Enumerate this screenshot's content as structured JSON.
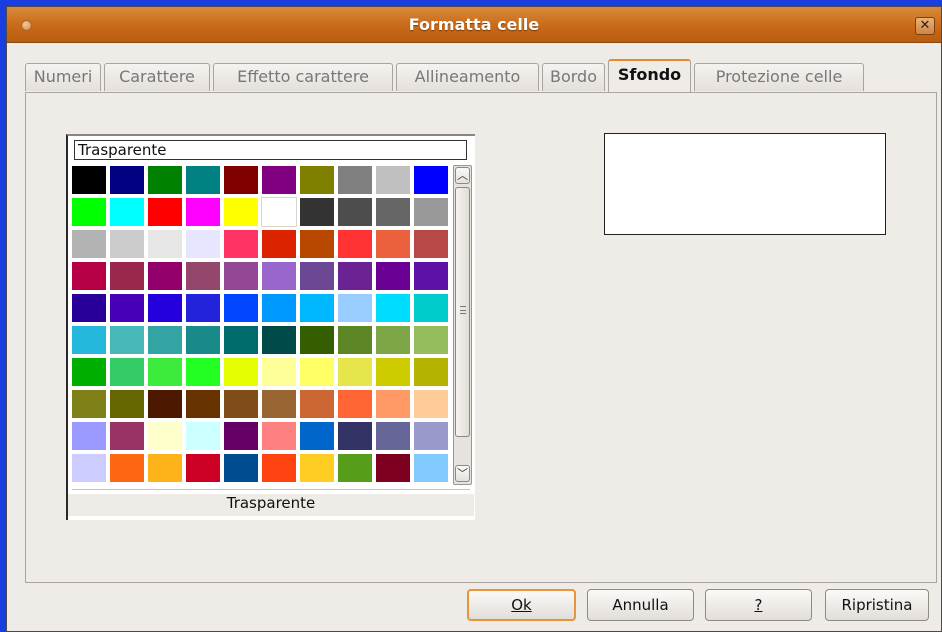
{
  "window": {
    "title": "Formatta celle"
  },
  "tabs": [
    {
      "label": "Numeri"
    },
    {
      "label": "Carattere"
    },
    {
      "label": "Effetto carattere"
    },
    {
      "label": "Allineamento"
    },
    {
      "label": "Bordo"
    },
    {
      "label": "Sfondo",
      "active": true
    },
    {
      "label": "Protezione celle"
    }
  ],
  "background": {
    "selected_color_name": "Trasparente",
    "palette_caption": "Trasparente",
    "preview_color": "#ffffff",
    "palette_rows": [
      [
        "#000000",
        "#000080",
        "#008000",
        "#008080",
        "#800000",
        "#800080",
        "#808000",
        "#808080",
        "#c0c0c0",
        "#0000ff"
      ],
      [
        "#00ff00",
        "#00ffff",
        "#ff0000",
        "#ff00ff",
        "#ffff00",
        "#ffffff",
        "#333333",
        "#4d4d4d",
        "#666666",
        "#999999"
      ],
      [
        "#b3b3b3",
        "#cccccc",
        "#e6e6e6",
        "#e6e6ff",
        "#ff3366",
        "#dc2300",
        "#b84700",
        "#ff3333",
        "#eb613d",
        "#b84747"
      ],
      [
        "#b80047",
        "#99284c",
        "#94006b",
        "#94476b",
        "#944794",
        "#9966cc",
        "#6b4794",
        "#6b2394",
        "#6b0094",
        "#5e11a6"
      ],
      [
        "#280099",
        "#4700b8",
        "#2300dc",
        "#2323dc",
        "#0047ff",
        "#0099ff",
        "#00b8ff",
        "#99ccff",
        "#00dcff",
        "#00cccc"
      ],
      [
        "#23b8dc",
        "#47b8b8",
        "#33a3a3",
        "#198a8a",
        "#006b6b",
        "#004a4a",
        "#355e00",
        "#5c8526",
        "#7da647",
        "#94bd5e"
      ],
      [
        "#00ae00",
        "#33cc66",
        "#3deb3d",
        "#23ff23",
        "#e6ff00",
        "#ffff99",
        "#ffff66",
        "#e6e64c",
        "#cccc00",
        "#b3b300"
      ],
      [
        "#808019",
        "#666600",
        "#4c1900",
        "#663300",
        "#804c19",
        "#996633",
        "#cc6633",
        "#ff6633",
        "#ff9966",
        "#ffcc99"
      ],
      [
        "#9999ff",
        "#993366",
        "#ffffcc",
        "#ccffff",
        "#660066",
        "#ff8080",
        "#0066cc",
        "#333366",
        "#666699",
        "#9999cc"
      ],
      [
        "#ccccff",
        "#ff6611",
        "#ffb31a",
        "#cc0022",
        "#004c91",
        "#ff4411",
        "#ffcc22",
        "#579d1c",
        "#7e0021",
        "#83caff"
      ]
    ]
  },
  "buttons": {
    "ok": "Ok",
    "cancel": "Annulla",
    "help": "?",
    "reset": "Ripristina"
  }
}
